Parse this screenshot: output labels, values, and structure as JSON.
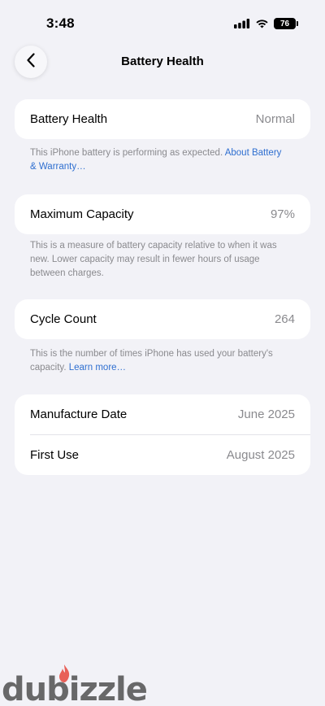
{
  "status_bar": {
    "time": "3:48",
    "battery_level": "76"
  },
  "nav": {
    "title": "Battery Health",
    "back_icon": "chevron-left-icon"
  },
  "battery_health": {
    "label": "Battery Health",
    "value": "Normal",
    "note_text": "This iPhone battery is performing as expected. ",
    "note_link": "About Battery & Warranty…"
  },
  "maximum_capacity": {
    "label": "Maximum Capacity",
    "value": "97%",
    "note_text": "This is a measure of battery capacity relative to when it was new. Lower capacity may result in fewer hours of usage between charges."
  },
  "cycle_count": {
    "label": "Cycle Count",
    "value": "264",
    "note_text": "This is the number of times iPhone has used your battery's capacity. ",
    "note_link": "Learn more…"
  },
  "dates": {
    "manufacture_label": "Manufacture Date",
    "manufacture_value": "June 2025",
    "first_use_label": "First Use",
    "first_use_value": "August 2025"
  },
  "watermark": {
    "text": "dubizzle"
  },
  "colors": {
    "background": "#f2f2f7",
    "card": "#ffffff",
    "link": "#2f6fd0",
    "secondary_text": "#8a8a8e"
  }
}
